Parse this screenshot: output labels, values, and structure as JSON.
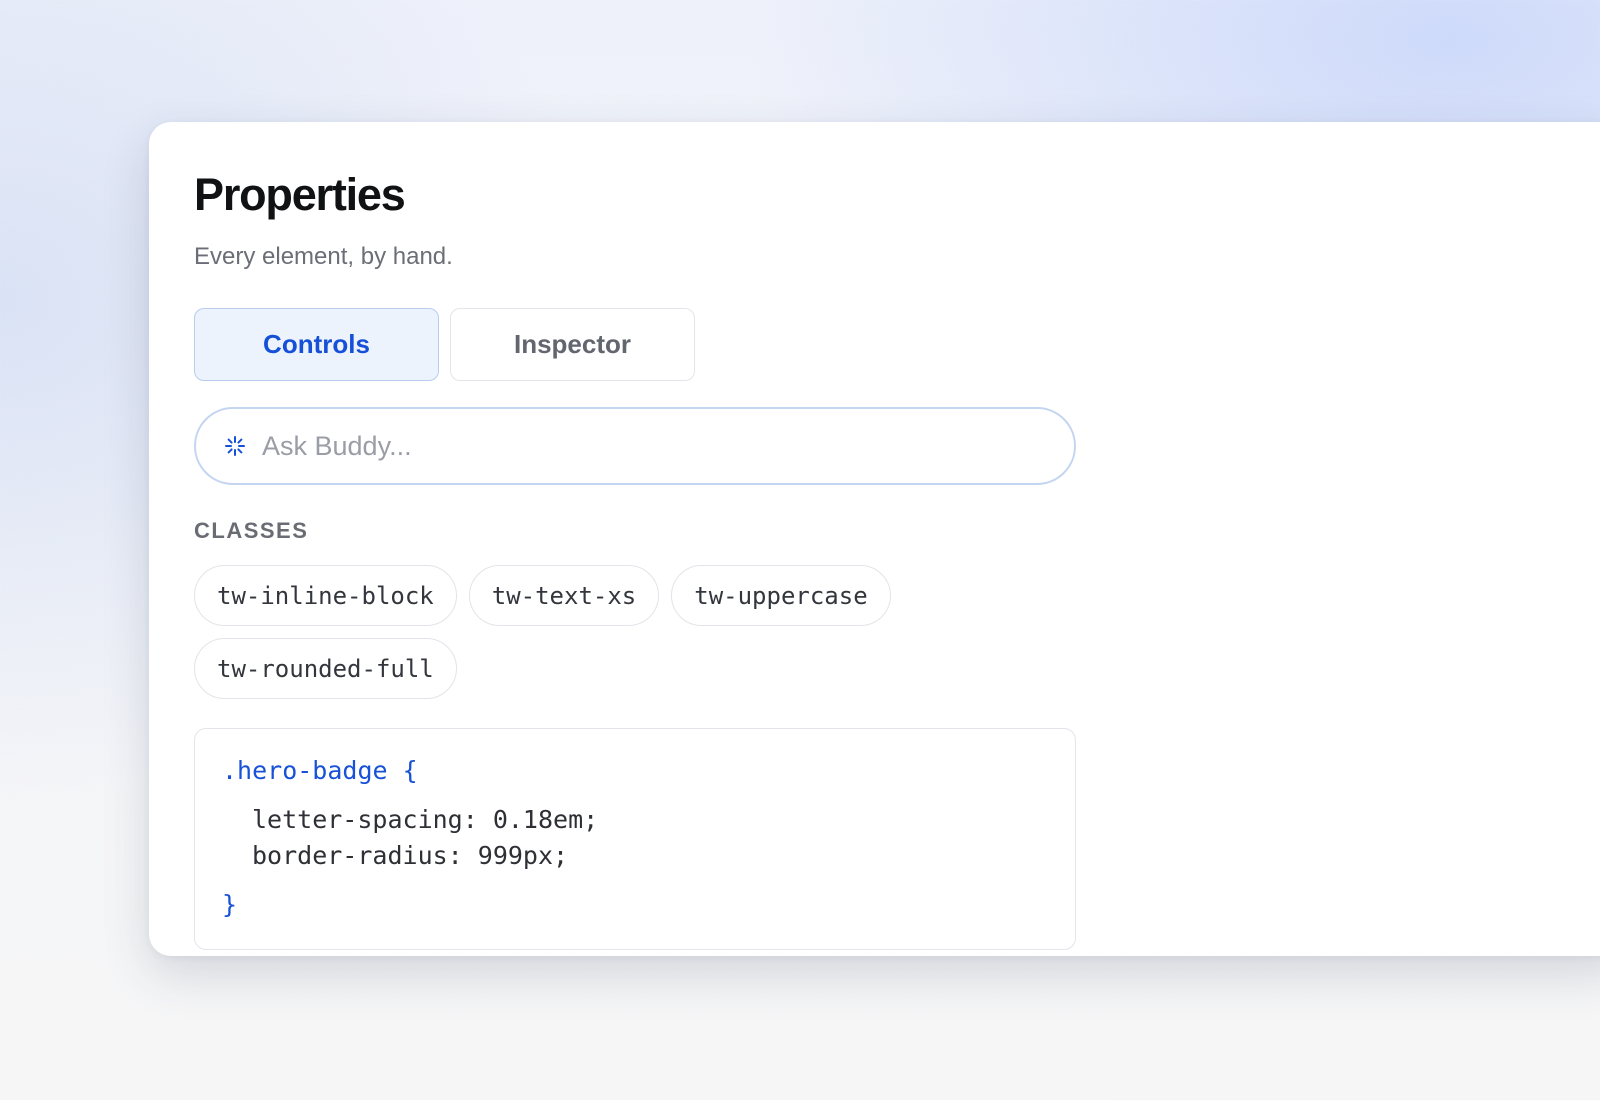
{
  "panel": {
    "title": "Properties",
    "subtitle": "Every element, by hand."
  },
  "tabs": [
    {
      "label": "Controls",
      "active": true
    },
    {
      "label": "Inspector",
      "active": false
    }
  ],
  "ask": {
    "placeholder": "Ask Buddy...",
    "icon": "sparkle-icon"
  },
  "classes": {
    "label": "CLASSES",
    "items": [
      "tw-inline-block",
      "tw-text-xs",
      "tw-uppercase",
      "tw-rounded-full"
    ]
  },
  "code": {
    "selector": ".hero-badge",
    "open_brace": "{",
    "declarations": [
      "letter-spacing: 0.18em;",
      "border-radius: 999px;"
    ],
    "close_brace": "}"
  },
  "colors": {
    "accent": "#1750d8",
    "tab_active_bg": "#edf3fd",
    "ask_border": "#c4d5f1"
  }
}
